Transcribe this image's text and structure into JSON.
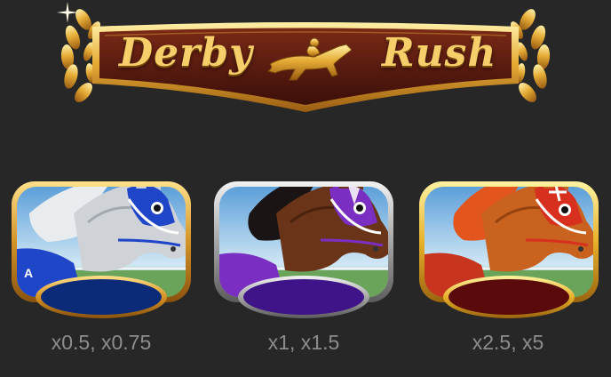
{
  "logo": {
    "word_left": "Derby",
    "word_right": "Rush",
    "emblem_icon": "jockey-horse-icon"
  },
  "horses": [
    {
      "multiplier": "x0.5, x0.75",
      "frame": "gold",
      "horse_coat": "grey",
      "mask_color": "#1f46c9",
      "oval_color": "#0b2a78"
    },
    {
      "multiplier": "x1, x1.5",
      "frame": "silver",
      "horse_coat": "bay",
      "mask_color": "#7a2fc2",
      "oval_color": "#3f1488"
    },
    {
      "multiplier": "x2.5, x5",
      "frame": "gold",
      "horse_coat": "chestnut",
      "mask_color": "#d8301e",
      "oval_color": "#5a0a0a"
    }
  ],
  "colors": {
    "background": "#272727",
    "gold": "#f0c24f",
    "wood": "#5a1c10",
    "caption": "#8d8d8d"
  }
}
